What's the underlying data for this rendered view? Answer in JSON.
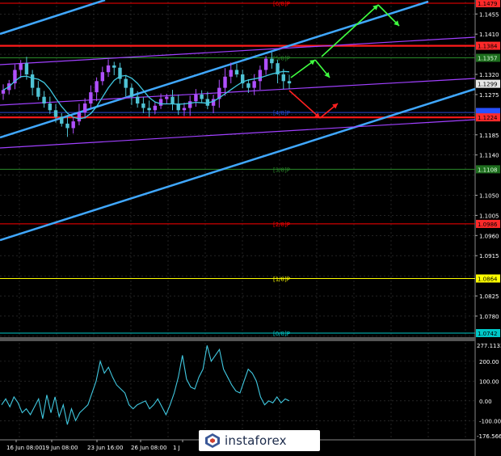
{
  "chart_data": [
    {
      "type": "candlestick",
      "xticks": [
        "16 Jun 08:00",
        "19 Jun 08:00",
        "23 Jun 16:00",
        "26 Jun 08:00",
        "1 J"
      ],
      "ylim": [
        1.0742,
        1.1479
      ],
      "price_ticks": [
        1.1455,
        1.141,
        1.1365,
        1.132,
        1.1275,
        1.123,
        1.1185,
        1.114,
        1.1095,
        1.105,
        1.1005,
        1.096,
        1.0915,
        1.087,
        1.0825,
        1.078,
        1.0735
      ],
      "current_price": 1.1299,
      "murrey_levels": [
        {
          "label": "[6/8]P",
          "value": 1.1479,
          "color": "#ff0000"
        },
        {
          "label": "[5/8]P",
          "value": 1.1357,
          "color": "#2a8a2a"
        },
        {
          "label": "[4/8]P",
          "value": 1.1235,
          "color": "#2a4ad0"
        },
        {
          "label": "[3/8]P",
          "value": 1.1108,
          "color": "#2a8a2a"
        },
        {
          "label": "[2/8]P",
          "value": 1.0986,
          "color": "#ff0000"
        },
        {
          "label": "[1/8]P",
          "value": 1.0864,
          "color": "#ffff00"
        },
        {
          "label": "[0/8]P",
          "value": 1.0742,
          "color": "#00c8c8"
        }
      ],
      "right_badges": [
        {
          "text": "1.1479",
          "value": 1.1479,
          "bg": "#ff2a2a",
          "fg": "#000000"
        },
        {
          "text": "1.1384",
          "value": 1.1384,
          "bg": "#ff2a2a",
          "fg": "#000000"
        },
        {
          "text": "1.1357",
          "value": 1.1357,
          "bg": "#1e6e1e",
          "fg": "#e0ffe0"
        },
        {
          "text": "1.1299",
          "value": 1.1299,
          "bg": "#e8e8e8",
          "fg": "#000000"
        },
        {
          "text": "",
          "value": 1.1236,
          "bg": "#2850ff",
          "fg": "#ffffff"
        },
        {
          "text": "1.1224",
          "value": 1.1224,
          "bg": "#ff2a2a",
          "fg": "#000000"
        },
        {
          "text": "1.1108",
          "value": 1.1108,
          "bg": "#1e6e1e",
          "fg": "#e0ffe0"
        },
        {
          "text": "1.0986",
          "value": 1.0986,
          "bg": "#ff2a2a",
          "fg": "#000000"
        },
        {
          "text": "1.0864",
          "value": 1.0864,
          "bg": "#ffff00",
          "fg": "#000000"
        },
        {
          "text": "1.0742",
          "value": 1.0742,
          "bg": "#00c8c8",
          "fg": "#000000"
        }
      ],
      "red_levels": [
        1.1384,
        1.1224
      ],
      "colors": {
        "background": "#000000",
        "grid": "#3a3a3a",
        "bull_candle": "#b050ff",
        "bear_candle": "#4fc3d4",
        "channel": "#40a8ff",
        "channel_inner": "#a040ff",
        "ma": "#40c8e0",
        "up_arrow": "#40ff40",
        "down_arrow": "#ff2020",
        "cci": "#40c8e0",
        "axis_text": "#ffffff"
      },
      "cci": {
        "yticks": [
          200,
          100,
          0,
          -100
        ],
        "top_label": "277.1133",
        "bottom_label": "-176.5666",
        "range": [
          -176.5666,
          277.1133
        ],
        "values": [
          -20,
          10,
          -30,
          20,
          -10,
          -60,
          -40,
          -70,
          -30,
          10,
          -90,
          30,
          -60,
          20,
          -80,
          -20,
          -120,
          -40,
          -100,
          -60,
          -40,
          -20,
          40,
          100,
          200,
          140,
          170,
          120,
          80,
          60,
          40,
          -20,
          -40,
          -20,
          -10,
          0,
          -40,
          -20,
          10,
          -30,
          -70,
          -20,
          40,
          120,
          230,
          110,
          70,
          60,
          120,
          160,
          280,
          200,
          230,
          260,
          160,
          120,
          80,
          50,
          40,
          100,
          160,
          140,
          100,
          20,
          -20,
          0,
          -10,
          20,
          -10,
          10,
          0
        ]
      }
    }
  ],
  "watermark": {
    "text": "instaforex"
  }
}
